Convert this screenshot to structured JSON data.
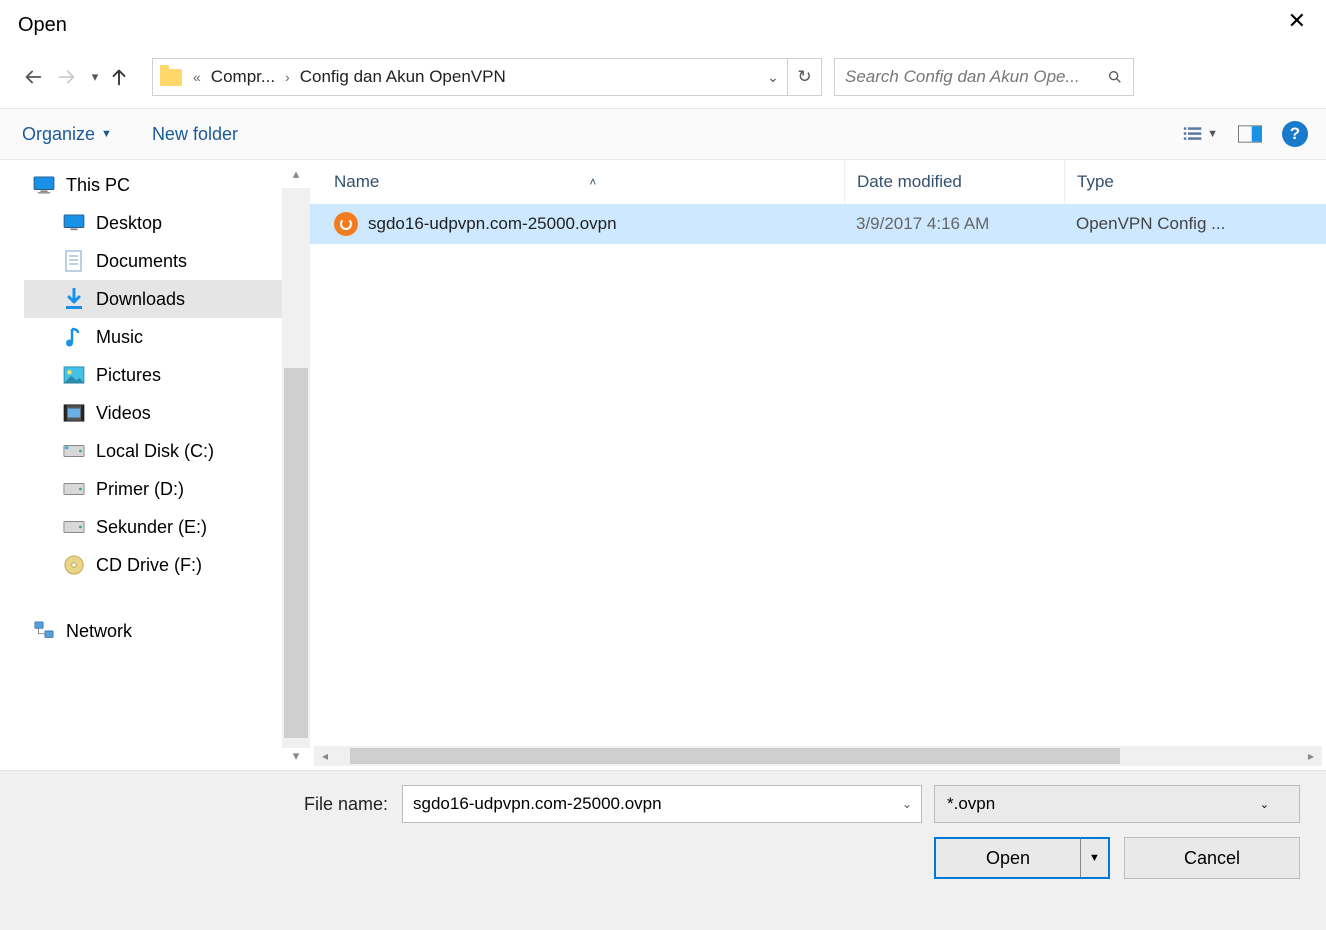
{
  "title": "Open",
  "nav": {
    "bc_prefix": "«",
    "bc_item1": "Compr...",
    "bc_item2": "Config dan Akun OpenVPN",
    "search_placeholder": "Search Config dan Akun Ope..."
  },
  "cmdbar": {
    "organize": "Organize",
    "new_folder": "New folder"
  },
  "cols": {
    "name": "Name",
    "date": "Date modified",
    "type": "Type"
  },
  "tree": {
    "this_pc": "This PC",
    "desktop": "Desktop",
    "documents": "Documents",
    "downloads": "Downloads",
    "music": "Music",
    "pictures": "Pictures",
    "videos": "Videos",
    "local_c": "Local Disk (C:)",
    "primer_d": "Primer (D:)",
    "sekunder_e": "Sekunder (E:)",
    "cd_f": "CD Drive (F:)",
    "network": "Network"
  },
  "files": [
    {
      "name": "sgdo16-udpvpn.com-25000.ovpn",
      "date": "3/9/2017 4:16 AM",
      "type": "OpenVPN Config ..."
    }
  ],
  "bottom": {
    "file_name_label": "File name:",
    "file_name_value": "sgdo16-udpvpn.com-25000.ovpn",
    "filter": "*.ovpn",
    "open": "Open",
    "cancel": "Cancel"
  }
}
